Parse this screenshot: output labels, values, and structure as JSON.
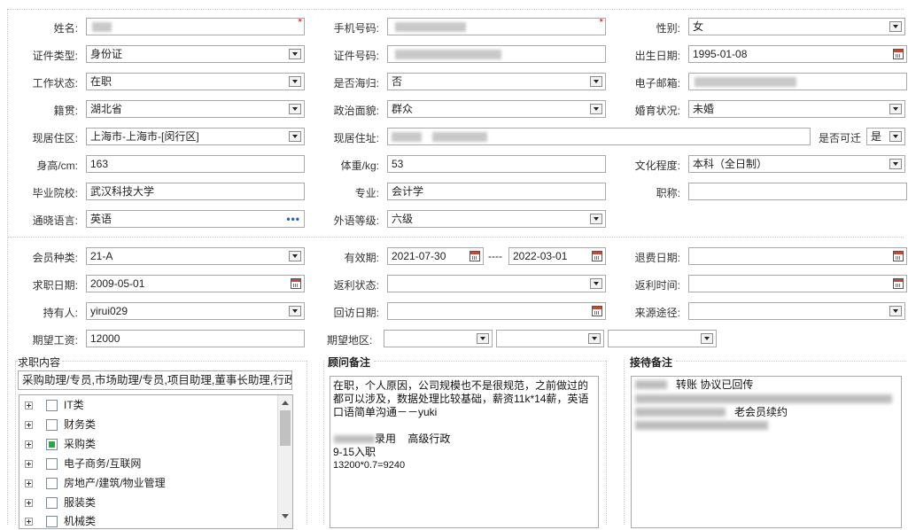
{
  "personal": {
    "name_label": "姓名:",
    "phone_label": "手机号码:",
    "gender_label": "性别:",
    "gender": "女",
    "id_type_label": "证件类型:",
    "id_type": "身份证",
    "id_no_label": "证件号码:",
    "birth_label": "出生日期:",
    "birth": "1995-01-08",
    "work_status_label": "工作状态:",
    "work_status": "在职",
    "returnee_label": "是否海归:",
    "returnee": "否",
    "email_label": "电子邮箱:",
    "native_label": "籍贯:",
    "native": "湖北省",
    "political_label": "政治面貌:",
    "political": "群众",
    "marital_label": "婚育状况:",
    "marital": "未婚",
    "residence_area_label": "现居住区:",
    "residence_area": "上海市-上海市-[闵行区]",
    "residence_addr_label": "现居住址:",
    "migratable_label": "是否可迁",
    "migratable": "是",
    "height_label": "身高/cm:",
    "height": "163",
    "weight_label": "体重/kg:",
    "weight": "53",
    "education_label": "文化程度:",
    "education": "本科（全日制）",
    "school_label": "毕业院校:",
    "school": "武汉科技大学",
    "major_label": "专业:",
    "major": "会计学",
    "title_label": "职称:",
    "language_label": "通晓语言:",
    "language": "英语",
    "foreign_level_label": "外语等级:",
    "foreign_level": "六级",
    "required_mark": "*",
    "more_dots": "•••"
  },
  "membership": {
    "member_type_label": "会员种类:",
    "member_type": "21-A",
    "valid_label": "有效期:",
    "valid_from": "2021-07-30",
    "valid_sep": "----",
    "valid_to": "2022-03-01",
    "refund_date_label": "退费日期:",
    "job_date_label": "求职日期:",
    "job_date": "2009-05-01",
    "rebate_status_label": "返利状态:",
    "rebate_time_label": "返利时间:",
    "holder_label": "持有人:",
    "holder": "yirui029",
    "visit_date_label": "回访日期:",
    "source_label": "来源途径:",
    "salary_label": "期望工资:",
    "salary": "12000",
    "region_label": "期望地区:"
  },
  "job_content": {
    "title": "求职内容",
    "summary": "采购助理/专员,市场助理/专员,项目助理,董事长助理,行政助",
    "categories": [
      {
        "label": "IT类",
        "checked": false
      },
      {
        "label": "财务类",
        "checked": false
      },
      {
        "label": "采购类",
        "checked": true
      },
      {
        "label": "电子商务/互联网",
        "checked": false
      },
      {
        "label": "房地产/建筑/物业管理",
        "checked": false
      },
      {
        "label": "服装类",
        "checked": false
      },
      {
        "label": "机械类",
        "checked": false
      }
    ]
  },
  "advisor_notes": {
    "title": "顾问备注",
    "line1": "在职，个人原因，公司规模也不是很规范，之前做过的",
    "line2": "都可以涉及，数据处理比较基础，薪资11k*14薪，英语",
    "line3": "口语简单沟通－－yuki",
    "line4": "录用    高级行政",
    "line5": "9-15入职",
    "line6": "13200*0.7=9240"
  },
  "reception_notes": {
    "title": "接待备注",
    "line1": "转账 协议已回传",
    "line2": "老会员续约"
  }
}
